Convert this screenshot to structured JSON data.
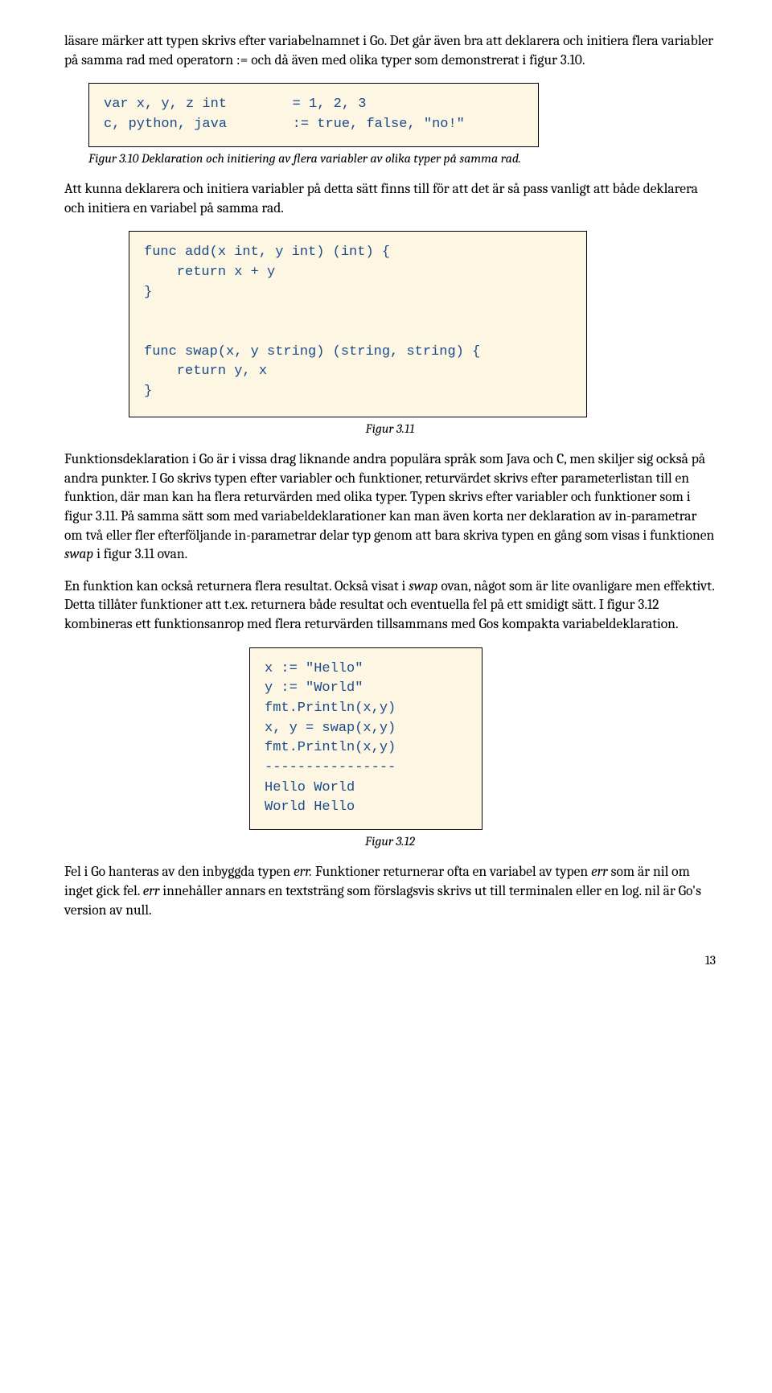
{
  "para1": "läsare märker att typen skrivs efter variabelnamnet i Go. Det går även bra att deklarera och initiera flera variabler på samma rad med operatorn := och då även med olika typer som demonstrerat i figur 3.10.",
  "code310": "var x, y, z int        = 1, 2, 3\nc, python, java        := true, false, \"no!\"",
  "caption310": "Figur 3.10 Deklaration och initiering av flera variabler av olika typer på samma rad.",
  "para2": "Att kunna deklarera och initiera variabler på detta sätt finns till för att det är så pass vanligt att både deklarera och initiera en variabel på samma rad.",
  "code311": "func add(x int, y int) (int) {\n    return x + y\n}\n\n\nfunc swap(x, y string) (string, string) {\n    return y, x\n}",
  "caption311": "Figur 3.11",
  "para3a": "Funktionsdeklaration i Go är i vissa drag liknande andra populära språk som Java och C, men skiljer sig också på andra punkter. I Go skrivs typen efter variabler och funktioner, returvärdet skrivs efter parameterlistan till en funktion, där man kan ha flera returvärden med olika typer. Typen skrivs efter variabler och funktioner som i figur 3.11. På samma sätt som med variabeldeklarationer kan man även korta ner deklaration av in-parametrar om två eller fler efterföljande in-parametrar delar typ genom att bara skriva typen en gång som visas i funktionen ",
  "para3b": " i figur 3.11 ovan.",
  "swap": "swap",
  "para4a": "En funktion kan också returnera flera resultat. Också visat i ",
  "para4b": " ovan, något som är lite ovanligare men effektivt. Detta tillåter funktioner att t.ex. returnera både resultat och eventuella fel på ett smidigt sätt. I figur 3.12 kombineras ett funktionsanrop med flera returvärden tillsammans med Gos kompakta variabeldeklaration.",
  "code312": "x := \"Hello\"\ny := \"World\"\nfmt.Println(x,y)\nx, y = swap(x,y)\nfmt.Println(x,y)\n----------------\nHello World\nWorld Hello",
  "caption312": "Figur 3.12",
  "para5a": "Fel i Go hanteras av den inbyggda typen ",
  "para5b": " Funktioner returnerar ofta en variabel av typen ",
  "para5c": " som är nil om inget gick fel. ",
  "para5d": " innehåller annars en textsträng som förslagsvis skrivs ut till terminalen eller en log. nil är Go's version av null.",
  "err": "err",
  "err_dot": "err.",
  "pagenum": "13"
}
